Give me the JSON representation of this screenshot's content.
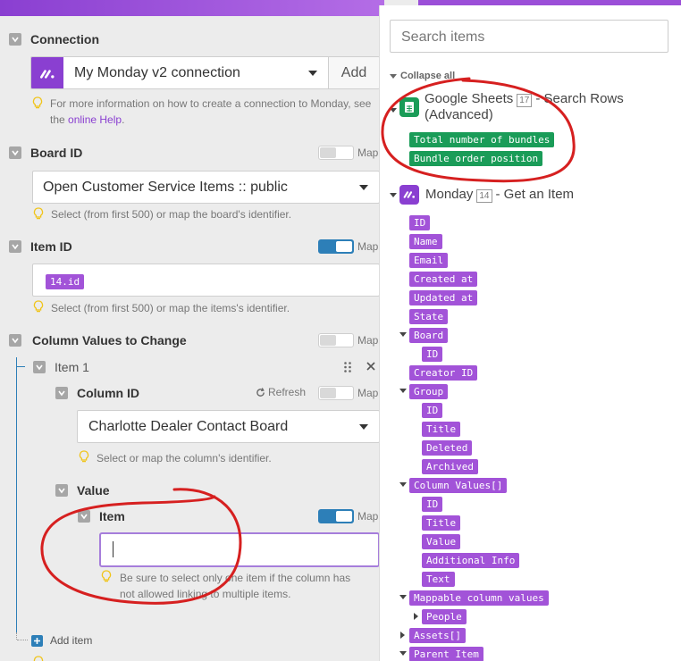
{
  "left": {
    "connection": {
      "label": "Connection",
      "value": "My Monday v2 connection",
      "add_label": "Add",
      "hint_prefix": "For more information on how to create a connection to Monday, see the",
      "hint_link": "online Help",
      "hint_suffix": "."
    },
    "board": {
      "label": "Board ID",
      "map_label": "Map",
      "value": "Open Customer Service Items :: public",
      "hint": "Select (from first 500) or map the board's identifier."
    },
    "item_id": {
      "label": "Item ID",
      "map_label": "Map",
      "token": "14.id",
      "hint": "Select (from first 500) or map the items's identifier."
    },
    "column_values": {
      "label": "Column Values to Change",
      "map_label": "Map",
      "item_label": "Item 1",
      "column_id": {
        "label": "Column ID",
        "refresh_label": "Refresh",
        "map_label": "Map",
        "value": "Charlotte Dealer Contact Board",
        "hint": "Select or map the column's identifier."
      },
      "value_label": "Value",
      "item": {
        "label": "Item",
        "map_label": "Map",
        "input_value": "",
        "hint_line1": "Be sure to select only one item if the column has",
        "hint_line2": "not allowed linking to multiple items."
      },
      "add_item_label": "Add item"
    }
  },
  "right": {
    "search_placeholder": "Search items",
    "collapse_label": "Collapse all",
    "modules": [
      {
        "name": "Google Sheets",
        "count": "17",
        "action": "- Search Rows",
        "action2": "(Advanced)",
        "items": [
          "Total number of bundles",
          "Bundle order position"
        ]
      },
      {
        "name": "Monday",
        "count": "14",
        "action": "- Get an Item",
        "items": [
          "ID",
          "Name",
          "Email",
          "Created at",
          "Updated at",
          "State",
          "Board",
          "ID",
          "Creator ID",
          "Group",
          "ID",
          "Title",
          "Deleted",
          "Archived",
          "Column Values[]",
          "ID",
          "Title",
          "Value",
          "Additional Info",
          "Text",
          "Mappable column values",
          "People",
          "Assets[]",
          "Parent Item"
        ]
      }
    ]
  },
  "colors": {
    "accent_purple": "#a253d8",
    "accent_green": "#1a9c58",
    "toggle_on": "#2d7fb8",
    "annotation_red": "#d62020"
  }
}
